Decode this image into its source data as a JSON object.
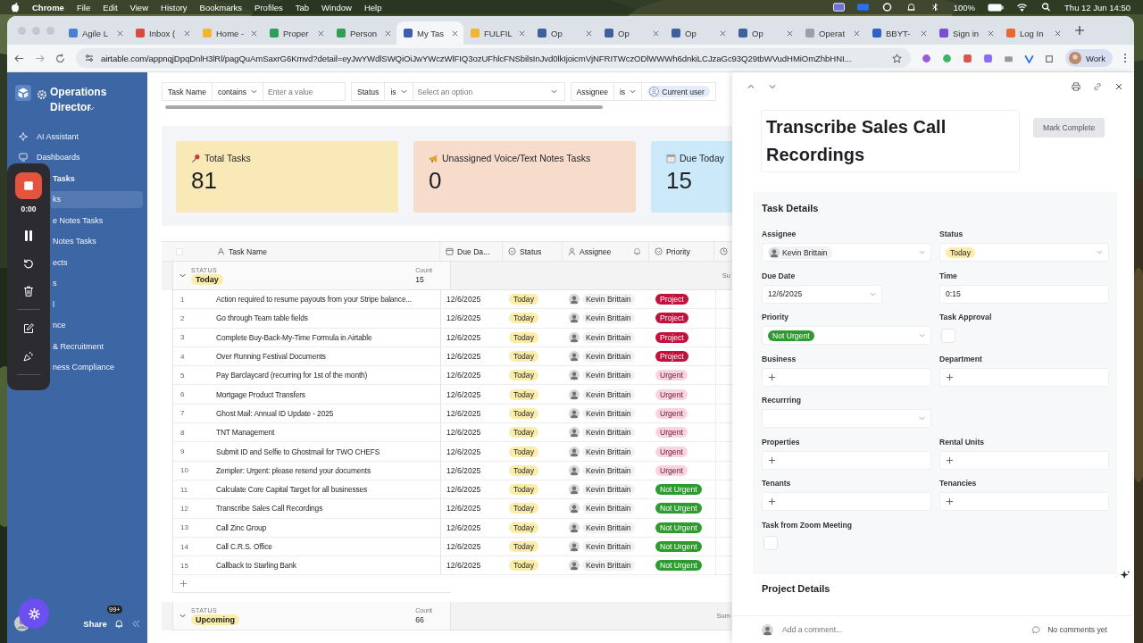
{
  "menu_bar": {
    "app": "Chrome",
    "menus": [
      "File",
      "Edit",
      "View",
      "History",
      "Bookmarks",
      "Profiles",
      "Tab",
      "Window",
      "Help"
    ],
    "battery": "100%",
    "clock": "Thu 12 Jun  14:50"
  },
  "browser": {
    "tabs": [
      {
        "title": "Agile L",
        "selected": false,
        "color": "#4a7fd6"
      },
      {
        "title": "Inbox (",
        "selected": false,
        "color": "#d94b3c"
      },
      {
        "title": "Home -",
        "selected": false,
        "color": "#f2b530"
      },
      {
        "title": "Proper",
        "selected": false,
        "color": "#2f9e57"
      },
      {
        "title": "Person",
        "selected": false,
        "color": "#2f9e57"
      },
      {
        "title": "My Tas",
        "selected": true,
        "color": "#3c5fa8"
      },
      {
        "title": "FULFIL",
        "selected": false,
        "color": "#f2b530"
      },
      {
        "title": "Op",
        "selected": false,
        "color": "#3f5f9f"
      },
      {
        "title": "Op",
        "selected": false,
        "color": "#3f5f9f"
      },
      {
        "title": "Op",
        "selected": false,
        "color": "#3f5f9f"
      },
      {
        "title": "Op",
        "selected": false,
        "color": "#3f5f9f"
      },
      {
        "title": "Operat",
        "selected": false,
        "color": "#9aa0a6"
      },
      {
        "title": "BBYT-",
        "selected": false,
        "color": "#2f62c9"
      },
      {
        "title": "Sign in",
        "selected": false,
        "color": "#7b4fd1"
      },
      {
        "title": "Log In",
        "selected": false,
        "color": "#e8682f"
      }
    ],
    "url": "airtable.com/appnqjDpqDnlH3lRl/pagQuAmSaxrG6Kmvd?detail=eyJwYWdlSWQiOiJwYWczWlFIQ3ozUFhlcFNSbilsInJvd0lkIjoicmVjNFRITWczODlWWWh6dnkiLCJzaGc93Q29tbWVudHMiOmZhbHNI...",
    "profile": "Work"
  },
  "sidebar": {
    "workspace": "Operations Director",
    "items": [
      {
        "label": "AI Assistant",
        "kind": "tool",
        "selected": false
      },
      {
        "label": "Dashboards",
        "kind": "tool",
        "selected": false
      },
      {
        "label": "Tasks",
        "kind": "section",
        "selected": false
      },
      {
        "label": "ks",
        "kind": "page",
        "selected": true
      },
      {
        "label": "e Notes Tasks",
        "kind": "page",
        "selected": false
      },
      {
        "label": "Notes Tasks",
        "kind": "page",
        "selected": false
      },
      {
        "label": "ects",
        "kind": "page",
        "selected": false
      },
      {
        "label": "s",
        "kind": "page",
        "selected": false
      },
      {
        "label": "l",
        "kind": "page",
        "selected": false
      },
      {
        "label": "nce",
        "kind": "page",
        "selected": false
      },
      {
        "label": "& Recruitment",
        "kind": "page",
        "selected": false
      },
      {
        "label": "ness Compliance",
        "kind": "page",
        "selected": false
      }
    ],
    "share": "Share",
    "badge": "99+"
  },
  "recorder": {
    "timer": "0:00"
  },
  "filters": [
    {
      "field": "Task Name",
      "operator": "contains",
      "kind": "text",
      "placeholder": "Enter a value"
    },
    {
      "field": "Status",
      "operator": "is",
      "kind": "select",
      "placeholder": "Select an option"
    },
    {
      "field": "Assignee",
      "operator": "is",
      "kind": "user",
      "value": "Current user"
    }
  ],
  "cards": [
    {
      "title": "Total Tasks",
      "value": "81",
      "color": "#f8e9b6"
    },
    {
      "title": "Unassigned Voice/Text Notes Tasks",
      "value": "0",
      "color": "#f7dccb"
    },
    {
      "title": "Due Today",
      "value": "15",
      "color": "#cbe9f8"
    }
  ],
  "table": {
    "columns": [
      "Task Name",
      "Due Da...",
      "Status",
      "Assignee",
      "Priority"
    ],
    "groups": [
      {
        "label": "STATUS",
        "value": "Today",
        "count_label": "Count",
        "count": "15",
        "sum": "Su",
        "expanded": true,
        "rows": [
          {
            "num": "1",
            "name": "Action required to resume payouts from your Stripe balance...",
            "due": "12/6/2025",
            "status": "Today",
            "assignee": "Kevin Brittain",
            "priority": {
              "label": "Project",
              "color": "#c3113d"
            }
          },
          {
            "num": "2",
            "name": "Go through Team table fields",
            "due": "12/6/2025",
            "status": "Today",
            "assignee": "Kevin Brittain",
            "priority": {
              "label": "Project",
              "color": "#c3113d"
            }
          },
          {
            "num": "3",
            "name": "Complete Buy-Back-My-Time Formula in Airtable",
            "due": "12/6/2025",
            "status": "Today",
            "assignee": "Kevin Brittain",
            "priority": {
              "label": "Project",
              "color": "#c3113d"
            }
          },
          {
            "num": "4",
            "name": "Over Running Festival Documents",
            "due": "12/6/2025",
            "status": "Today",
            "assignee": "Kevin Brittain",
            "priority": {
              "label": "Project",
              "color": "#c3113d"
            }
          },
          {
            "num": "5",
            "name": "Pay Barclaycard (recurring for 1st of the month)",
            "due": "12/6/2025",
            "status": "Today",
            "assignee": "Kevin Brittain",
            "priority": {
              "label": "Urgent",
              "color": "#fbd3de"
            }
          },
          {
            "num": "6",
            "name": "Mortgage Product Transfers",
            "due": "12/6/2025",
            "status": "Today",
            "assignee": "Kevin Brittain",
            "priority": {
              "label": "Urgent",
              "color": "#fbd3de"
            }
          },
          {
            "num": "7",
            "name": "Ghost Mail: Annual ID Update - 2025",
            "due": "12/6/2025",
            "status": "Today",
            "assignee": "Kevin Brittain",
            "priority": {
              "label": "Urgent",
              "color": "#fbd3de"
            }
          },
          {
            "num": "8",
            "name": "TNT Management",
            "due": "12/6/2025",
            "status": "Today",
            "assignee": "Kevin Brittain",
            "priority": {
              "label": "Urgent",
              "color": "#fbd3de"
            }
          },
          {
            "num": "9",
            "name": "Submit ID and Selfie to Ghostmail for TWO CHEFS",
            "due": "12/6/2025",
            "status": "Today",
            "assignee": "Kevin Brittain",
            "priority": {
              "label": "Urgent",
              "color": "#fbd3de"
            }
          },
          {
            "num": "10",
            "name": "Zempler: Urgent: please resend your documents",
            "due": "12/6/2025",
            "status": "Today",
            "assignee": "Kevin Brittain",
            "priority": {
              "label": "Urgent",
              "color": "#fbd3de"
            }
          },
          {
            "num": "11",
            "name": "Calculate Core Capital Target for all businesses",
            "due": "12/6/2025",
            "status": "Today",
            "assignee": "Kevin Brittain",
            "priority": {
              "label": "Not Urgent",
              "color": "#2e9b2f"
            }
          },
          {
            "num": "12",
            "name": "Transcribe Sales Call Recordings",
            "due": "12/6/2025",
            "status": "Today",
            "assignee": "Kevin Brittain",
            "priority": {
              "label": "Not Urgent",
              "color": "#2e9b2f"
            }
          },
          {
            "num": "13",
            "name": "Call Zinc Group",
            "due": "12/6/2025",
            "status": "Today",
            "assignee": "Kevin Brittain",
            "priority": {
              "label": "Not Urgent",
              "color": "#2e9b2f"
            }
          },
          {
            "num": "14",
            "name": "Call C.R.S. Office",
            "due": "12/6/2025",
            "status": "Today",
            "assignee": "Kevin Brittain",
            "priority": {
              "label": "Not Urgent",
              "color": "#2e9b2f"
            }
          },
          {
            "num": "15",
            "name": "Callback to Starling Bank",
            "due": "12/6/2025",
            "status": "Today",
            "assignee": "Kevin Brittain",
            "priority": {
              "label": "Not Urgent",
              "color": "#2e9b2f"
            }
          }
        ]
      },
      {
        "label": "STATUS",
        "value": "Upcoming",
        "count_label": "Count",
        "count": "66",
        "sum": "Sum",
        "expanded": true
      }
    ]
  },
  "panel": {
    "title": "Transcribe Sales Call Recordings",
    "action": "Mark Complete",
    "section": "Task Details",
    "field_rows": [
      [
        {
          "label": "Assignee",
          "kind": "user",
          "value": "Kevin Brittain"
        },
        {
          "label": "Status",
          "kind": "status",
          "value": "Today"
        }
      ],
      [
        {
          "label": "Due Date",
          "kind": "date",
          "value": "12/6/2025"
        },
        {
          "label": "Time",
          "kind": "text",
          "value": "0:15"
        }
      ],
      [
        {
          "label": "Priority",
          "kind": "priority",
          "value": "Not Urgent",
          "color": "#2e9b2f"
        },
        {
          "label": "Task Approval",
          "kind": "checkbox",
          "checked": false
        }
      ],
      [
        {
          "label": "Business",
          "kind": "link"
        },
        {
          "label": "Department",
          "kind": "link"
        }
      ],
      [
        {
          "label": "Recurrring",
          "kind": "select"
        }
      ],
      [
        {
          "label": "Properties",
          "kind": "link"
        },
        {
          "label": "Rental Units",
          "kind": "link"
        }
      ],
      [
        {
          "label": "Tenants",
          "kind": "link"
        },
        {
          "label": "Tenancies",
          "kind": "link"
        }
      ],
      [
        {
          "label": "Task from Zoom Meeting",
          "kind": "checkbox",
          "checked": false
        }
      ]
    ],
    "next_section": "Project Details",
    "comment_placeholder": "Add a comment...",
    "comments": "No comments yet"
  }
}
